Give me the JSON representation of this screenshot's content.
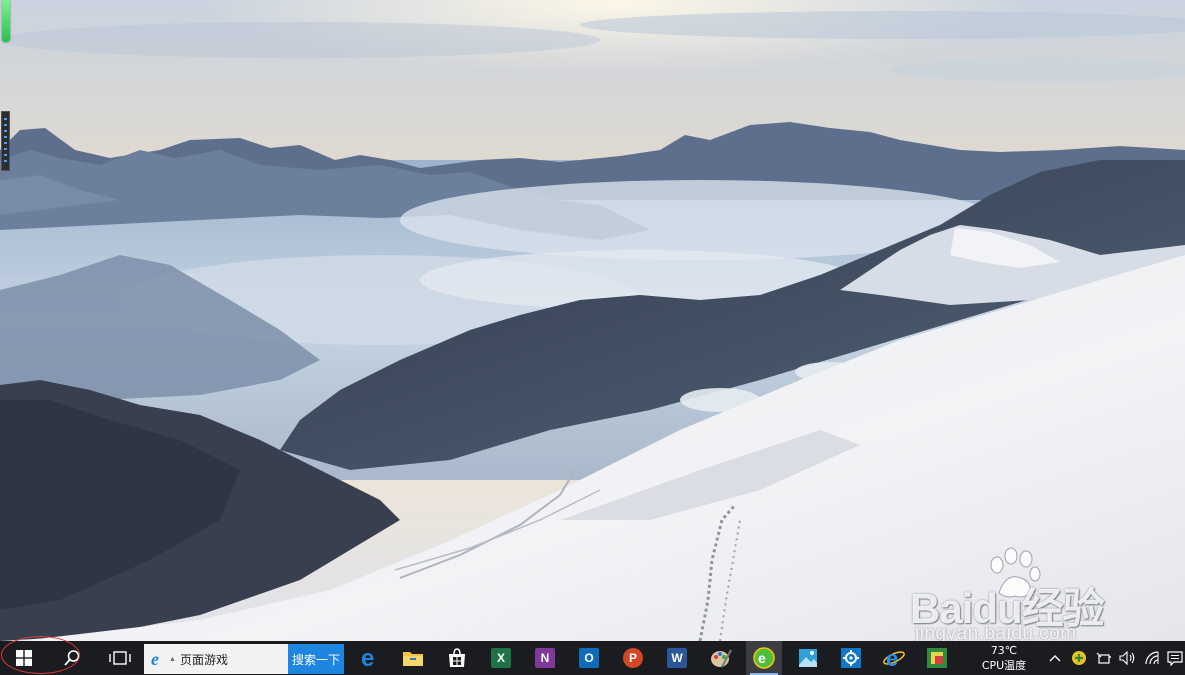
{
  "watermark": {
    "logo_text": "Baidu经验",
    "url": "jingyan.baidu.com"
  },
  "taskbar": {
    "search_value": "页面游戏",
    "search_button": "搜索一下",
    "cpu_temp": "73℃",
    "cpu_label": "CPU温度",
    "pinned_apps": [
      "edge-icon",
      "file-explorer-icon",
      "store-icon",
      "excel-icon",
      "onenote-icon",
      "outlook-icon",
      "powerpoint-icon",
      "word-icon",
      "paint-icon",
      "browser-360-icon",
      "photos-icon",
      "settings-icon",
      "internet-explorer-icon",
      "green-app-icon"
    ]
  },
  "colors": {
    "taskbar": "#1b1c1f",
    "search_button": "#1e86e0",
    "annotation_circle": "#e23b3b",
    "excel": "#1f7346",
    "onenote": "#80399b",
    "outlook": "#0f6cbd",
    "powerpoint": "#d24726",
    "word": "#2b579a",
    "edge": "#1e86e0"
  }
}
